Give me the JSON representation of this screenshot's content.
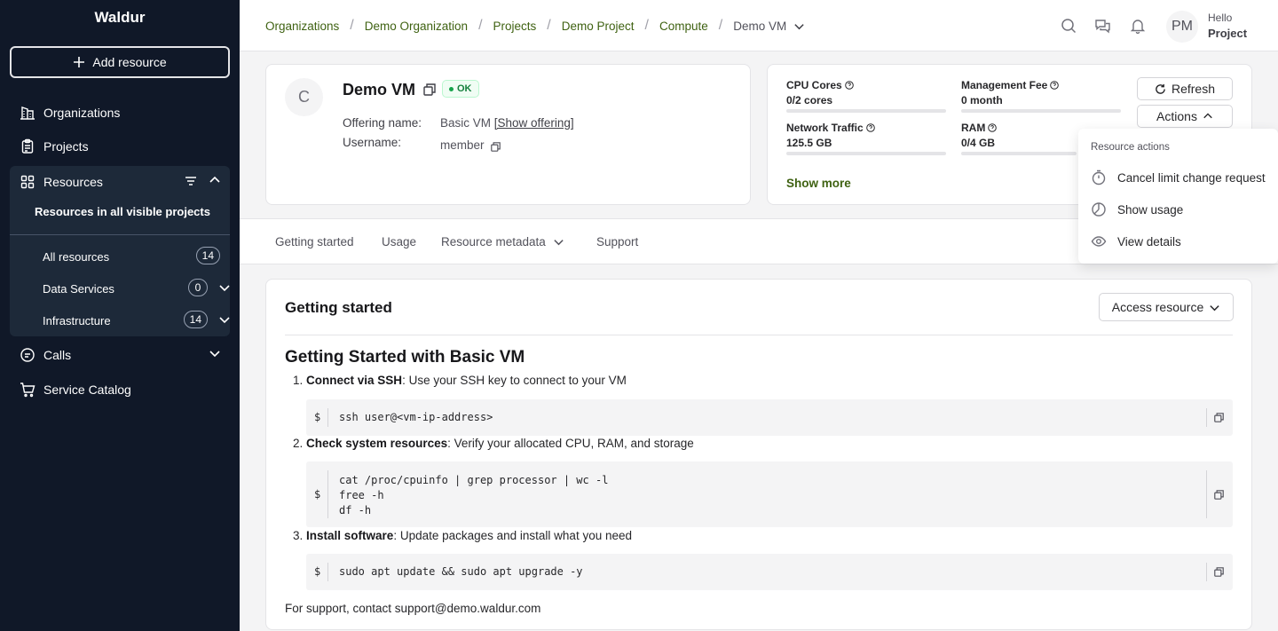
{
  "sidebar": {
    "brand": "Waldur",
    "add_resource": "Add resource",
    "organizations": "Organizations",
    "projects": "Projects",
    "resources": {
      "label": "Resources",
      "scope": "Resources in all visible projects",
      "items": [
        {
          "label": "All resources",
          "count": "14"
        },
        {
          "label": "Data Services",
          "count": "0"
        },
        {
          "label": "Infrastructure",
          "count": "14"
        }
      ]
    },
    "calls": "Calls",
    "service_catalog": "Service Catalog"
  },
  "breadcrumb": {
    "items": [
      "Organizations",
      "Demo Organization",
      "Projects",
      "Demo Project",
      "Compute"
    ],
    "current": "Demo VM"
  },
  "user": {
    "initials": "PM",
    "greeting": "Hello",
    "name": "Project"
  },
  "resource": {
    "avatar": "C",
    "name": "Demo VM",
    "status": "OK",
    "offering_label": "Offering name:",
    "offering_value": "Basic VM",
    "offering_link": "[Show offering]",
    "username_label": "Username:",
    "username_value": "member"
  },
  "metrics": [
    {
      "label": "CPU Cores",
      "value": "0/2 cores",
      "fill": 0
    },
    {
      "label": "Management Fee",
      "value": "0 month",
      "fill": 0
    },
    {
      "label": "Network Traffic",
      "value": "125.5 GB",
      "fill": 0
    },
    {
      "label": "RAM",
      "value": "0/4 GB",
      "fill": 0
    }
  ],
  "show_more": "Show more",
  "buttons": {
    "refresh": "Refresh",
    "actions": "Actions",
    "access_resource": "Access resource"
  },
  "dropdown": {
    "header": "Resource actions",
    "items": [
      "Cancel limit change request",
      "Show usage",
      "View details"
    ]
  },
  "tabs": [
    "Getting started",
    "Usage",
    "Resource metadata",
    "Support"
  ],
  "getting_started": {
    "title": "Getting started",
    "heading": "Getting Started with Basic VM",
    "steps": [
      {
        "num": "1.",
        "bold": "Connect via SSH",
        "text": ": Use your SSH key to connect to your VM",
        "code": "ssh user@<vm-ip-address>"
      },
      {
        "num": "2.",
        "bold": "Check system resources",
        "text": ": Verify your allocated CPU, RAM, and storage",
        "code": "cat /proc/cpuinfo | grep processor | wc -l\nfree -h\ndf -h"
      },
      {
        "num": "3.",
        "bold": "Install software",
        "text": ": Update packages and install what you need",
        "code": "sudo apt update && sudo apt upgrade -y"
      }
    ],
    "prompt": "$",
    "footer": "For support, contact support@demo.waldur.com"
  },
  "colors": {
    "sidebar_bg": "#101828",
    "link_green": "#3f6212",
    "status_green": "#15803d"
  }
}
